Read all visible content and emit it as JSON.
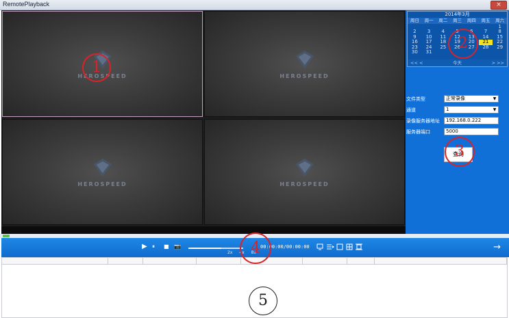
{
  "window": {
    "title": "RemotePlayback",
    "close_glyph": "×"
  },
  "video": {
    "watermark": "HEROSPEED"
  },
  "calendar": {
    "header": "2014年3月",
    "weekdays": [
      "周日",
      "周一",
      "周二",
      "周三",
      "周四",
      "周五",
      "周六"
    ],
    "days": [
      "",
      "",
      "",
      "",
      "",
      "",
      "1",
      "2",
      "3",
      "4",
      "5",
      "6",
      "7",
      "8",
      "9",
      "10",
      "11",
      "12",
      "13",
      "14",
      "15",
      "16",
      "17",
      "18",
      "19",
      "20",
      "21",
      "22",
      "23",
      "24",
      "25",
      "26",
      "27",
      "28",
      "29",
      "30",
      "31",
      "",
      "",
      "",
      "",
      ""
    ],
    "today_index": 26,
    "prev": "<< <",
    "today_label": "今天",
    "next": "> >>"
  },
  "form": {
    "file_type_label": "文件类型",
    "file_type_value": "正常录像",
    "channel_label": "通道",
    "channel_value": "1",
    "server_addr_label": "录像服务器地址",
    "server_addr_value": "192.168.0.222",
    "server_port_label": "服务器端口",
    "server_port_value": "5000",
    "query_label": "查询",
    "dropdown_glyph": "▼"
  },
  "toolbar": {
    "play_icon": "▶",
    "pause_icon": "⏸",
    "stop_icon": "■",
    "snapshot_icon": "📷",
    "speeds": "2x 4x 8x",
    "time": "00:00:00/00:00:00",
    "next_arrow": "→"
  },
  "list": {
    "columns": [
      "",
      "",
      "",
      "",
      "",
      "",
      "",
      ""
    ]
  },
  "annotations": [
    "1",
    "2",
    "3",
    "4",
    "5"
  ]
}
